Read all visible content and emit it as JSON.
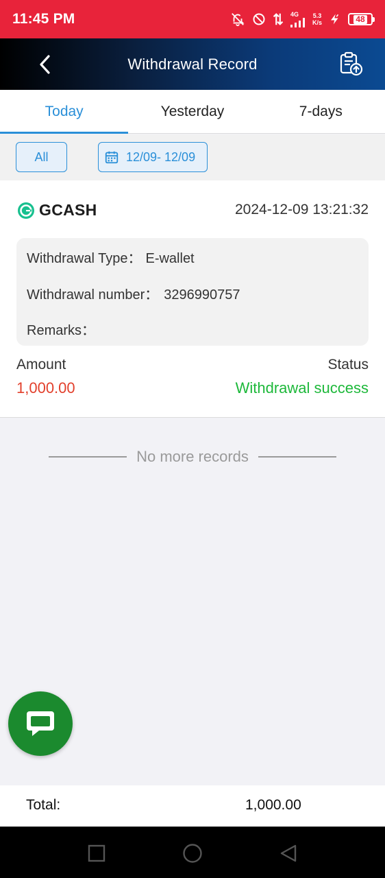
{
  "status_bar": {
    "time": "11:45 PM",
    "network_type": "4G",
    "speed_value": "5.3",
    "speed_unit": "K/s",
    "battery": "48"
  },
  "header": {
    "title": "Withdrawal Record"
  },
  "tabs": [
    {
      "label": "Today",
      "active": true
    },
    {
      "label": "Yesterday",
      "active": false
    },
    {
      "label": "7-days",
      "active": false
    }
  ],
  "filters": {
    "all_label": "All",
    "date_range": "12/09- 12/09"
  },
  "record": {
    "brand": "GCASH",
    "datetime": "2024-12-09 13:21:32",
    "type_label": "Withdrawal Type：",
    "type_value": "E-wallet",
    "number_label": "Withdrawal number：",
    "number_value": "3296990757",
    "remarks_label": "Remarks：",
    "remarks_value": "",
    "amount_label": "Amount",
    "amount_value": "1,000.00",
    "status_label": "Status",
    "status_value": "Withdrawal success"
  },
  "list_end": {
    "text": "No more records"
  },
  "footer": {
    "total_label": "Total:",
    "total_value": "1,000.00"
  },
  "colors": {
    "status_bar": "#e8233a",
    "accent": "#2a8fd8",
    "amount": "#e2402c",
    "success": "#1db83a",
    "chat_fab": "#1b8a2e",
    "brand_logo": "#18c08f"
  }
}
